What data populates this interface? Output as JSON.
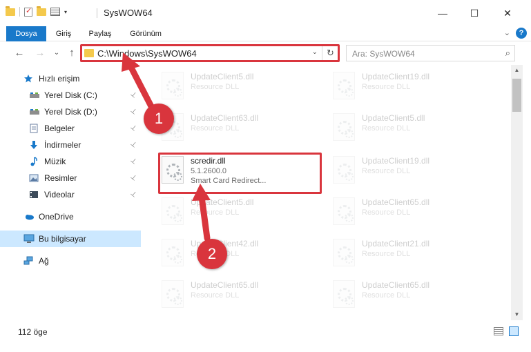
{
  "window": {
    "title": "SysWOW64",
    "minimize": "—",
    "maximize": "☐",
    "close": "✕"
  },
  "ribbon": {
    "tabs": [
      {
        "label": "Dosya",
        "active": true
      },
      {
        "label": "Giriş"
      },
      {
        "label": "Paylaş"
      },
      {
        "label": "Görünüm"
      }
    ],
    "help": "?"
  },
  "nav": {
    "back": "←",
    "forward": "→",
    "recent": "⌄",
    "up": "↑"
  },
  "address": {
    "path": "C:\\Windows\\SysWOW64",
    "dropdown": "⌄",
    "refresh": "↻"
  },
  "search": {
    "placeholder": "Ara: SysWOW64",
    "icon": "⌕"
  },
  "sidebar": {
    "items": [
      {
        "label": "Hızlı erişim",
        "icon": "star-icon",
        "pinned": false
      },
      {
        "label": "Yerel Disk (C:)",
        "icon": "drive-icon",
        "pinned": true
      },
      {
        "label": "Yerel Disk (D:)",
        "icon": "drive-icon",
        "pinned": true
      },
      {
        "label": "Belgeler",
        "icon": "documents-icon",
        "pinned": true
      },
      {
        "label": "İndirmeler",
        "icon": "download-icon",
        "pinned": true
      },
      {
        "label": "Müzik",
        "icon": "music-icon",
        "pinned": true
      },
      {
        "label": "Resimler",
        "icon": "pictures-icon",
        "pinned": true
      },
      {
        "label": "Videolar",
        "icon": "videos-icon",
        "pinned": true
      },
      {
        "label": "OneDrive",
        "icon": "cloud-icon",
        "pinned": false
      },
      {
        "label": "Bu bilgisayar",
        "icon": "computer-icon",
        "pinned": false,
        "selected": true
      },
      {
        "label": "Ağ",
        "icon": "network-icon",
        "pinned": false
      }
    ],
    "pin_glyph": "📌"
  },
  "files": [
    {
      "name": "UpdateClient5.dll",
      "desc": "Resource DLL",
      "faded": true
    },
    {
      "name": "UpdateClient19.dll",
      "desc": "Resource DLL",
      "faded": true
    },
    {
      "name": "UpdateClient63.dll",
      "desc": "Resource DLL",
      "faded": true
    },
    {
      "name": "UpdateClient5.dll",
      "desc": "Resource DLL",
      "faded": true
    },
    {
      "name": "scredir.dll",
      "desc": "5.1.2600.0",
      "ver": "Smart Card Redirect...",
      "faded": false
    },
    {
      "name": "UpdateClient19.dll",
      "desc": "Resource DLL",
      "faded": true
    },
    {
      "name": "UpdateClient5.dll",
      "desc": "Resource DLL",
      "faded": true
    },
    {
      "name": "UpdateClient65.dll",
      "desc": "Resource DLL",
      "faded": true
    },
    {
      "name": "UpdateClient42.dll",
      "desc": "Resource DLL",
      "faded": true
    },
    {
      "name": "UpdateClient21.dll",
      "desc": "Resource DLL",
      "faded": true
    },
    {
      "name": "UpdateClient65.dll",
      "desc": "Resource DLL",
      "faded": true
    },
    {
      "name": "UpdateClient65.dll",
      "desc": "Resource DLL",
      "faded": true
    }
  ],
  "status": {
    "count": "112 öge"
  },
  "annotations": {
    "step1": "1",
    "step2": "2",
    "color": "#d9353d"
  }
}
